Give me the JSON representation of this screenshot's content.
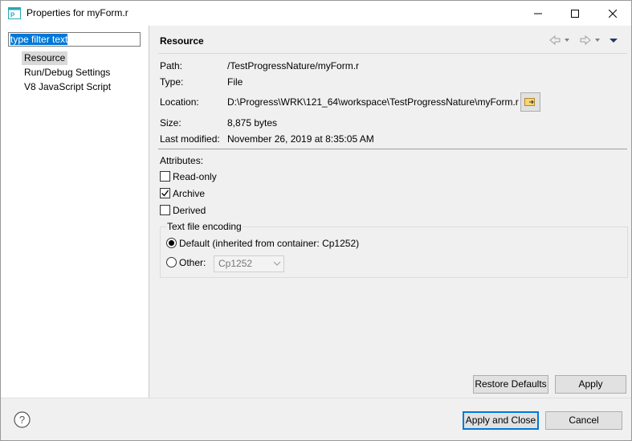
{
  "window": {
    "title": "Properties for myForm.r"
  },
  "sidebar": {
    "filter_text": "type filter text",
    "items": [
      {
        "label": "Resource"
      },
      {
        "label": "Run/Debug Settings"
      },
      {
        "label": "V8 JavaScript Script"
      }
    ]
  },
  "page": {
    "title": "Resource",
    "path_label": "Path:",
    "path_value": "/TestProgressNature/myForm.r",
    "type_label": "Type:",
    "type_value": "File",
    "location_label": "Location:",
    "location_value": "D:\\Progress\\WRK\\121_64\\workspace\\TestProgressNature\\myForm.r",
    "size_label": "Size:",
    "size_value": "8,875  bytes",
    "modified_label": "Last modified:",
    "modified_value": "November 26, 2019 at 8:35:05 AM",
    "attributes_label": "Attributes:",
    "readonly_label": "Read-only",
    "readonly_checked": false,
    "archive_label": "Archive",
    "archive_checked": true,
    "derived_label": "Derived",
    "derived_checked": false,
    "encoding_group_label": "Text file encoding",
    "default_radio_label": "Default (inherited from container: Cp1252)",
    "default_selected": true,
    "other_radio_label": "Other:",
    "other_value": "Cp1252"
  },
  "buttons": {
    "restore_defaults": "Restore Defaults",
    "apply": "Apply",
    "apply_and_close": "Apply and Close",
    "cancel": "Cancel"
  },
  "icons": {
    "app": "properties-app-icon",
    "minimize": "minimize-icon",
    "maximize": "maximize-icon",
    "close": "close-icon",
    "back": "back-arrow-icon",
    "forward": "forward-arrow-icon",
    "menu": "view-menu-icon",
    "open_location": "open-location-icon",
    "help": "help-icon"
  },
  "colors": {
    "selection": "#0078d7",
    "tree_selected": "#d9d9d9",
    "icon_teal": "#2aa7b8"
  }
}
